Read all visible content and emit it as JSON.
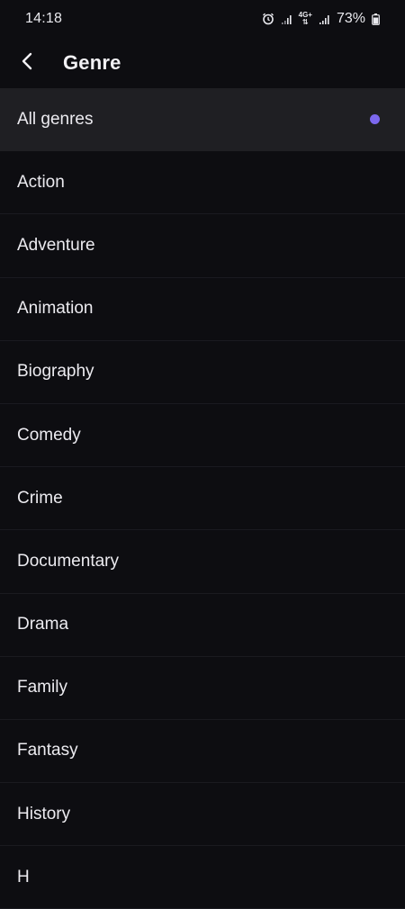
{
  "status_bar": {
    "time": "14:18",
    "network": "4G+",
    "battery": "73%",
    "icons": [
      "alarm-icon",
      "signal-icon",
      "network-4g-icon",
      "signal-icon",
      "battery-icon"
    ]
  },
  "header": {
    "title": "Genre",
    "back_icon": "chevron-left-icon"
  },
  "genres": {
    "selected": "All genres",
    "accent_color": "#7c68ee",
    "items": [
      {
        "label": "All genres",
        "selected": true
      },
      {
        "label": "Action",
        "selected": false
      },
      {
        "label": "Adventure",
        "selected": false
      },
      {
        "label": "Animation",
        "selected": false
      },
      {
        "label": "Biography",
        "selected": false
      },
      {
        "label": "Comedy",
        "selected": false
      },
      {
        "label": "Crime",
        "selected": false
      },
      {
        "label": "Documentary",
        "selected": false
      },
      {
        "label": "Drama",
        "selected": false
      },
      {
        "label": "Family",
        "selected": false
      },
      {
        "label": "Fantasy",
        "selected": false
      },
      {
        "label": "History",
        "selected": false
      },
      {
        "label": "H",
        "selected": false
      }
    ]
  }
}
